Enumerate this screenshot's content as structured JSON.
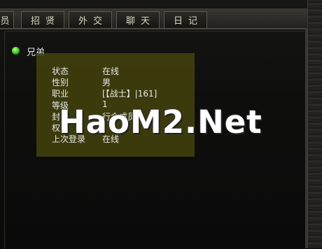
{
  "tabs": [
    {
      "label": "员"
    },
    {
      "label": "招贤"
    },
    {
      "label": "外交"
    },
    {
      "label": "聊天"
    },
    {
      "label": "日记"
    }
  ],
  "group": {
    "label": "兄弟"
  },
  "member_info": {
    "rows": [
      {
        "key": "状态",
        "value": "在线"
      },
      {
        "key": "性别",
        "value": "男"
      },
      {
        "key": "职业",
        "value": "[【战士】|161]"
      },
      {
        "key": "等级",
        "value": "1"
      },
      {
        "key": "封",
        "value": "行会成员"
      },
      {
        "key": "权",
        "value": ""
      },
      {
        "key": "上次登录",
        "value": "在线"
      }
    ]
  },
  "watermark": "HaoM2.Net",
  "colors": {
    "online": "#37c222",
    "tooltip_bg": "#46440e"
  }
}
